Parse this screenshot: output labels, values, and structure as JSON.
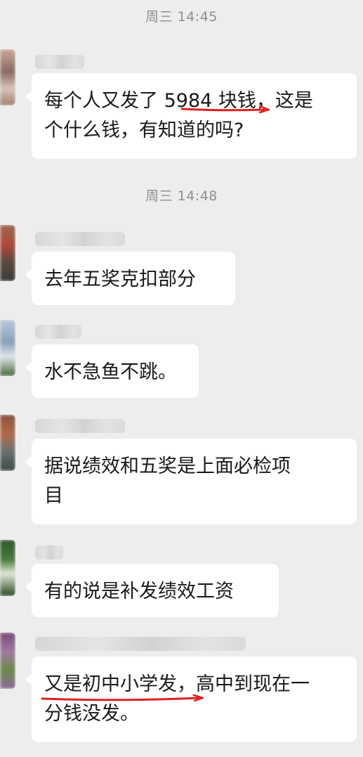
{
  "colors": {
    "background": "#ededed",
    "bubble": "#ffffff",
    "annotation": "#e02020"
  },
  "timestamps": [
    "周三 14:45",
    "周三 14:48"
  ],
  "messages": [
    {
      "lines": [
        "每个人又发了 5984 块钱，这是",
        "个什么钱，有知道的吗?"
      ]
    },
    {
      "lines": [
        "去年五奖克扣部分"
      ]
    },
    {
      "lines": [
        "水不急鱼不跳。"
      ]
    },
    {
      "lines": [
        "据说绩效和五奖是上面必检项",
        "目"
      ]
    },
    {
      "lines": [
        "有的说是补发绩效工资"
      ]
    },
    {
      "lines": [
        "又是初中小学发，高中到现在一",
        "分钱没发。"
      ]
    }
  ]
}
